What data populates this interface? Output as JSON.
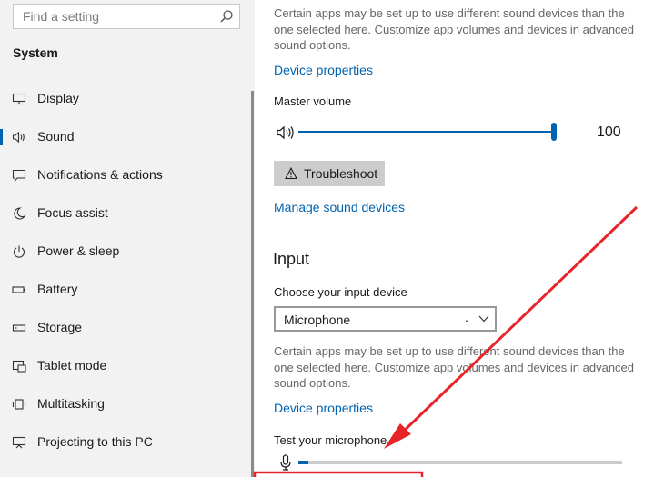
{
  "sidebar": {
    "search_placeholder": "Find a setting",
    "section_title": "System",
    "items": [
      {
        "label": "Display",
        "icon": "monitor-icon"
      },
      {
        "label": "Sound",
        "icon": "speaker-icon",
        "selected": true
      },
      {
        "label": "Notifications & actions",
        "icon": "notification-icon"
      },
      {
        "label": "Focus assist",
        "icon": "moon-icon"
      },
      {
        "label": "Power & sleep",
        "icon": "power-icon"
      },
      {
        "label": "Battery",
        "icon": "battery-icon"
      },
      {
        "label": "Storage",
        "icon": "storage-icon"
      },
      {
        "label": "Tablet mode",
        "icon": "tablet-icon"
      },
      {
        "label": "Multitasking",
        "icon": "multitasking-icon"
      },
      {
        "label": "Projecting to this PC",
        "icon": "projecting-icon"
      }
    ]
  },
  "output": {
    "description": "Certain apps may be set up to use different sound devices than the one selected here. Customize app volumes and devices in advanced sound options.",
    "device_properties_link": "Device properties",
    "master_volume_label": "Master volume",
    "volume_value": "100",
    "volume_level": 1.0,
    "troubleshoot_label": "Troubleshoot",
    "manage_link": "Manage sound devices"
  },
  "input": {
    "heading": "Input",
    "choose_label": "Choose your input device",
    "selected_device": "Microphone",
    "device_suffix": ".",
    "description": "Certain apps may be set up to use different sound devices than the one selected here. Customize app volumes and devices in advanced sound options.",
    "device_properties_link": "Device properties",
    "test_label": "Test your microphone",
    "mic_level": 0.03
  },
  "colors": {
    "accent": "#0063b1",
    "annotation_arrow": "#e8242b",
    "sidebar_bg": "#f2f2f2"
  }
}
